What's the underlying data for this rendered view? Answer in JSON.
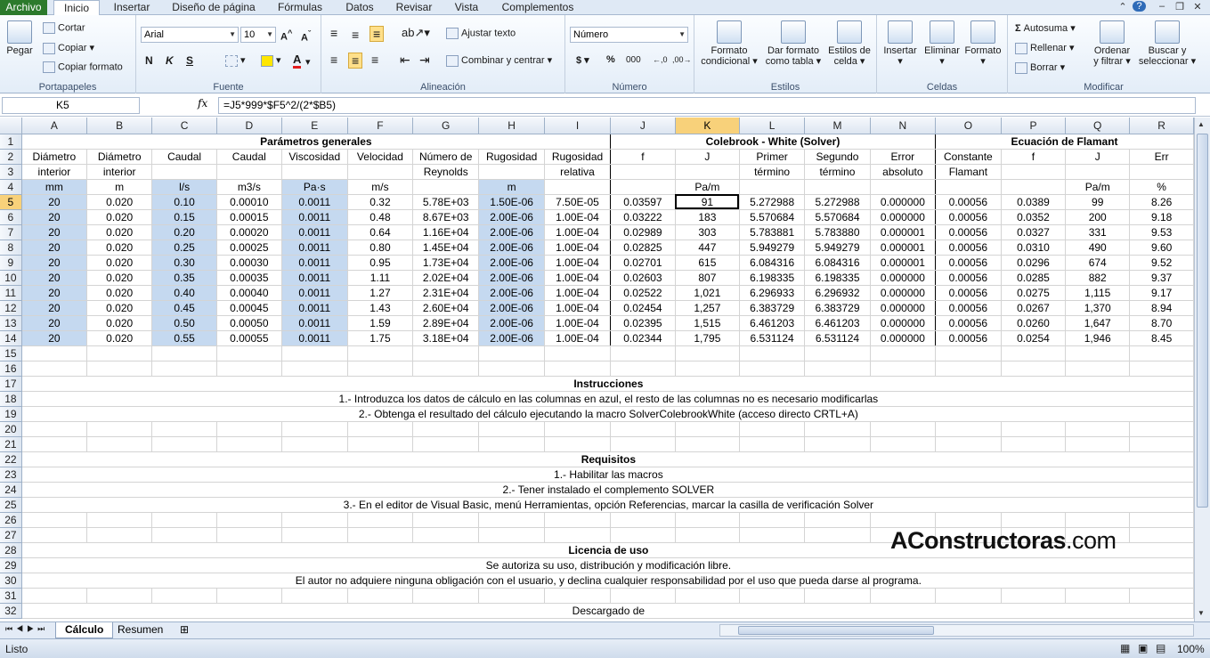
{
  "ribbon_tabs": [
    "Archivo",
    "Inicio",
    "Insertar",
    "Diseño de página",
    "Fórmulas",
    "Datos",
    "Revisar",
    "Vista",
    "Complementos"
  ],
  "clipboard": {
    "paste": "Pegar",
    "cut": "Cortar",
    "copy": "Copiar",
    "format_painter": "Copiar formato",
    "label": "Portapapeles"
  },
  "font": {
    "name": "Arial",
    "size": "10",
    "label": "Fuente"
  },
  "alignment": {
    "wrap": "Ajustar texto",
    "merge": "Combinar y centrar",
    "label": "Alineación"
  },
  "number": {
    "format": "Número",
    "label": "Número"
  },
  "styles": {
    "conditional": [
      "Formato",
      "condicional"
    ],
    "table": [
      "Dar formato",
      "como tabla"
    ],
    "cell": [
      "Estilos de",
      "celda"
    ],
    "label": "Estilos"
  },
  "cells": {
    "insert": "Insertar",
    "delete": "Eliminar",
    "format": "Formato",
    "label": "Celdas"
  },
  "editing": {
    "autosum": "Autosuma",
    "fill": "Rellenar",
    "clear": "Borrar",
    "sort": [
      "Ordenar",
      "y filtrar"
    ],
    "find": [
      "Buscar y",
      "seleccionar"
    ],
    "label": "Modificar"
  },
  "formula_bar": {
    "name_box": "K5",
    "fx": "fx",
    "formula": "=J5*999*$F5^2/(2*$B5)"
  },
  "columns": [
    "A",
    "B",
    "C",
    "D",
    "E",
    "F",
    "G",
    "H",
    "I",
    "J",
    "K",
    "L",
    "M",
    "N",
    "O",
    "P",
    "Q",
    "R"
  ],
  "header_rows": {
    "r1": {
      "general": "Parámetros generales",
      "colebrook": "Colebrook - White (Solver)",
      "flamant": "Ecuación de Flamant"
    },
    "r2": [
      "Diámetro",
      "Diámetro",
      "Caudal",
      "Caudal",
      "Viscosidad",
      "Velocidad",
      "Número de",
      "Rugosidad",
      "Rugosidad",
      "f",
      "J",
      "Primer",
      "Segundo",
      "Error",
      "Constante",
      "f",
      "J",
      "Err"
    ],
    "r3": [
      "interior",
      "interior",
      "",
      "",
      "",
      "",
      "Reynolds",
      "",
      "relativa",
      "",
      "",
      "término",
      "término",
      "absoluto",
      "Flamant",
      "",
      "",
      ""
    ],
    "r4": [
      "mm",
      "m",
      "l/s",
      "m3/s",
      "Pa·s",
      "m/s",
      "",
      "m",
      "",
      "",
      "Pa/m",
      "",
      "",
      "",
      "",
      "",
      "Pa/m",
      "%"
    ]
  },
  "rows": [
    [
      "20",
      "0.020",
      "0.10",
      "0.00010",
      "0.0011",
      "0.32",
      "5.78E+03",
      "1.50E-06",
      "7.50E-05",
      "0.03597",
      "91",
      "5.272988",
      "5.272988",
      "0.000000",
      "0.00056",
      "0.0389",
      "99",
      "8.26"
    ],
    [
      "20",
      "0.020",
      "0.15",
      "0.00015",
      "0.0011",
      "0.48",
      "8.67E+03",
      "2.00E-06",
      "1.00E-04",
      "0.03222",
      "183",
      "5.570684",
      "5.570684",
      "0.000000",
      "0.00056",
      "0.0352",
      "200",
      "9.18"
    ],
    [
      "20",
      "0.020",
      "0.20",
      "0.00020",
      "0.0011",
      "0.64",
      "1.16E+04",
      "2.00E-06",
      "1.00E-04",
      "0.02989",
      "303",
      "5.783881",
      "5.783880",
      "0.000001",
      "0.00056",
      "0.0327",
      "331",
      "9.53"
    ],
    [
      "20",
      "0.020",
      "0.25",
      "0.00025",
      "0.0011",
      "0.80",
      "1.45E+04",
      "2.00E-06",
      "1.00E-04",
      "0.02825",
      "447",
      "5.949279",
      "5.949279",
      "0.000001",
      "0.00056",
      "0.0310",
      "490",
      "9.60"
    ],
    [
      "20",
      "0.020",
      "0.30",
      "0.00030",
      "0.0011",
      "0.95",
      "1.73E+04",
      "2.00E-06",
      "1.00E-04",
      "0.02701",
      "615",
      "6.084316",
      "6.084316",
      "0.000001",
      "0.00056",
      "0.0296",
      "674",
      "9.52"
    ],
    [
      "20",
      "0.020",
      "0.35",
      "0.00035",
      "0.0011",
      "1.11",
      "2.02E+04",
      "2.00E-06",
      "1.00E-04",
      "0.02603",
      "807",
      "6.198335",
      "6.198335",
      "0.000000",
      "0.00056",
      "0.0285",
      "882",
      "9.37"
    ],
    [
      "20",
      "0.020",
      "0.40",
      "0.00040",
      "0.0011",
      "1.27",
      "2.31E+04",
      "2.00E-06",
      "1.00E-04",
      "0.02522",
      "1,021",
      "6.296933",
      "6.296932",
      "0.000000",
      "0.00056",
      "0.0275",
      "1,115",
      "9.17"
    ],
    [
      "20",
      "0.020",
      "0.45",
      "0.00045",
      "0.0011",
      "1.43",
      "2.60E+04",
      "2.00E-06",
      "1.00E-04",
      "0.02454",
      "1,257",
      "6.383729",
      "6.383729",
      "0.000000",
      "0.00056",
      "0.0267",
      "1,370",
      "8.94"
    ],
    [
      "20",
      "0.020",
      "0.50",
      "0.00050",
      "0.0011",
      "1.59",
      "2.89E+04",
      "2.00E-06",
      "1.00E-04",
      "0.02395",
      "1,515",
      "6.461203",
      "6.461203",
      "0.000000",
      "0.00056",
      "0.0260",
      "1,647",
      "8.70"
    ],
    [
      "20",
      "0.020",
      "0.55",
      "0.00055",
      "0.0011",
      "1.75",
      "3.18E+04",
      "2.00E-06",
      "1.00E-04",
      "0.02344",
      "1,795",
      "6.531124",
      "6.531124",
      "0.000000",
      "0.00056",
      "0.0254",
      "1,946",
      "8.45"
    ]
  ],
  "notes": {
    "r17": "Instrucciones",
    "r18": "1.- Introduzca los datos de cálculo en las columnas en azul, el resto de las columnas no es necesario modificarlas",
    "r19": "2.- Obtenga el resultado del cálculo ejecutando la macro SolverColebrookWhite (acceso directo CRTL+A)",
    "r22": "Requisitos",
    "r23": "1.- Habilitar las macros",
    "r24": "2.- Tener instalado el complemento SOLVER",
    "r25": "3.- En el editor de Visual Basic, menú Herramientas, opción Referencias, marcar la casilla de verificación Solver",
    "r28": "Licencia de uso",
    "r29": "Se autoriza su uso, distribución y modificación libre.",
    "r30": "El autor no adquiere ninguna obligación con el usuario, y declina cualquier responsabilidad por el uso que pueda darse al programa.",
    "r32": "Descargado de"
  },
  "logo": {
    "first": "A",
    "second": "Constructoras",
    ".com": ".com"
  },
  "sheet_tabs": [
    "Cálculo",
    "Resumen"
  ],
  "status": {
    "ready": "Listo",
    "zoom": "100%"
  }
}
